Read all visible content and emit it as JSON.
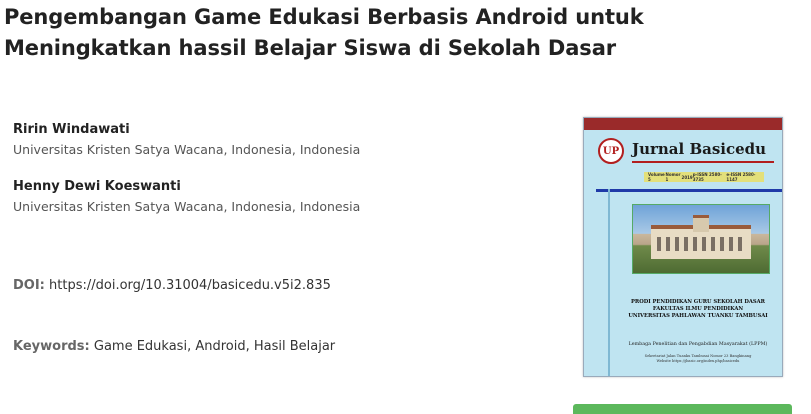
{
  "article": {
    "title": "Pengembangan Game Edukasi Berbasis Android untuk Meningkatkan hassil Belajar Siswa di Sekolah Dasar"
  },
  "authors": [
    {
      "name": "Ririn Windawati",
      "affiliation": "Universitas Kristen Satya Wacana, Indonesia, Indonesia"
    },
    {
      "name": "Henny Dewi Koeswanti",
      "affiliation": "Universitas Kristen Satya Wacana, Indonesia, Indonesia"
    }
  ],
  "doi": {
    "label": "DOI:",
    "value": "https://doi.org/10.31004/basicedu.v5i2.835"
  },
  "keywords": {
    "label": "Keywords:",
    "value": "Game Edukasi, Android, Hasil Belajar"
  },
  "cover": {
    "logo_text": "UP",
    "journal_name": "Jurnal Basicedu",
    "infobar": [
      "Volume 5",
      "Nomor 1",
      "2019",
      "p-ISSN 2580-3735",
      "e-ISSN 2580-1147"
    ],
    "prodi_lines": [
      "PRODI PENDIDIKAN GURU SEKOLAH DASAR",
      "FAKULTAS ILMU PENDIDIKAN",
      "UNIVERSITAS PAHLAWAN TUANKU TAMBUSAI"
    ],
    "lppm": "Lembaga Penelitian dan Pengabdian Masyarakat (LPPM)",
    "address_lines": [
      "Sekretariat Jalan Tuanku Tambusai Nomor 23 Bangkinang",
      "Website https://jbasic.org/index.php/basicedu"
    ]
  },
  "colors": {
    "accent_green": "#5cb85c",
    "cover_red": "#9a2a2a",
    "cover_blue": "#1f3aa8"
  }
}
